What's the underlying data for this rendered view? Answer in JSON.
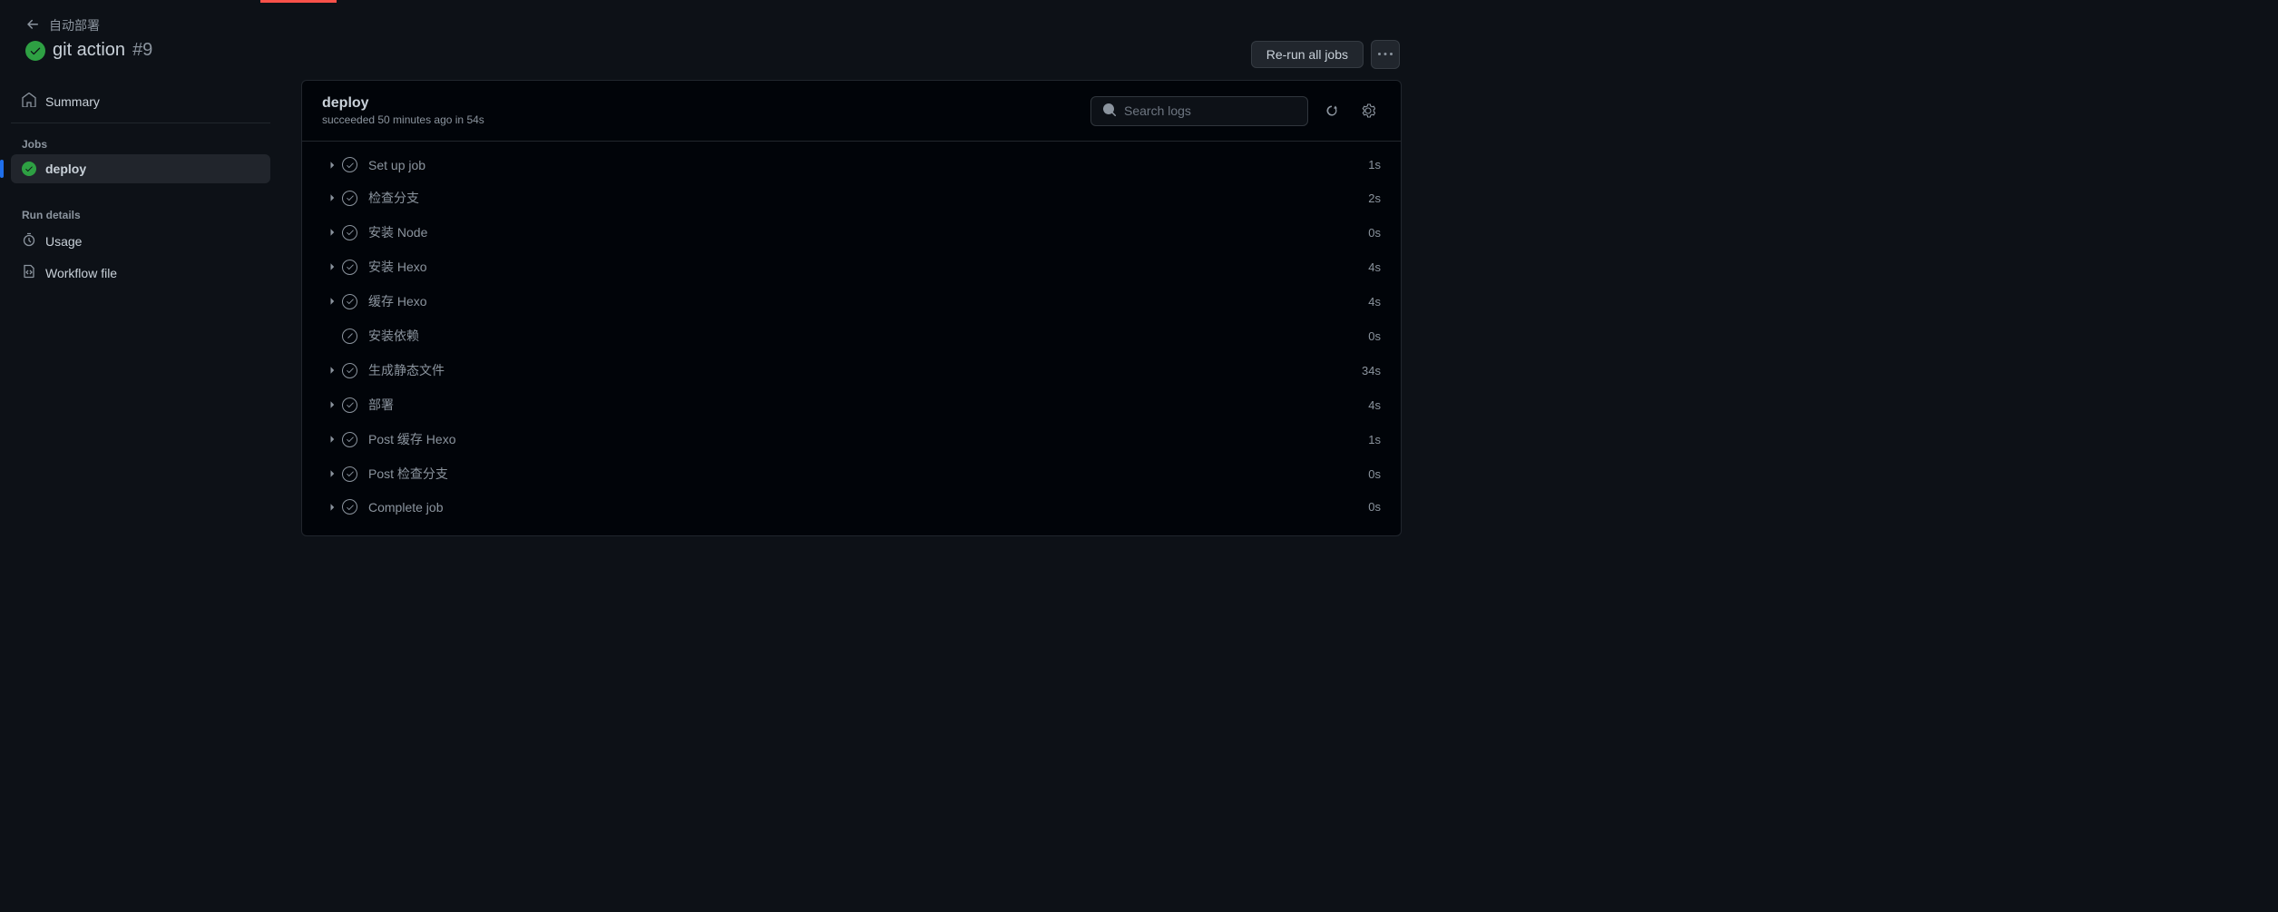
{
  "breadcrumb": {
    "label": "自动部署"
  },
  "workflow": {
    "title": "git action",
    "number": "#9"
  },
  "header_actions": {
    "rerun_label": "Re-run all jobs"
  },
  "sidebar": {
    "summary": "Summary",
    "jobs_heading": "Jobs",
    "run_details_heading": "Run details",
    "usage": "Usage",
    "workflow_file": "Workflow file",
    "jobs": [
      {
        "name": "deploy",
        "status": "success",
        "active": true
      }
    ]
  },
  "panel": {
    "job_name": "deploy",
    "subtext": "succeeded 50 minutes ago in 54s",
    "search_placeholder": "Search logs",
    "steps": [
      {
        "name": "Set up job",
        "duration": "1s",
        "status": "success",
        "expandable": true
      },
      {
        "name": "检查分支",
        "duration": "2s",
        "status": "success",
        "expandable": true
      },
      {
        "name": "安装 Node",
        "duration": "0s",
        "status": "success",
        "expandable": true
      },
      {
        "name": "安装 Hexo",
        "duration": "4s",
        "status": "success",
        "expandable": true
      },
      {
        "name": "缓存 Hexo",
        "duration": "4s",
        "status": "success",
        "expandable": true
      },
      {
        "name": "安装依赖",
        "duration": "0s",
        "status": "skipped",
        "expandable": false
      },
      {
        "name": "生成静态文件",
        "duration": "34s",
        "status": "success",
        "expandable": true
      },
      {
        "name": "部署",
        "duration": "4s",
        "status": "success",
        "expandable": true
      },
      {
        "name": "Post 缓存 Hexo",
        "duration": "1s",
        "status": "success",
        "expandable": true
      },
      {
        "name": "Post 检查分支",
        "duration": "0s",
        "status": "success",
        "expandable": true
      },
      {
        "name": "Complete job",
        "duration": "0s",
        "status": "success",
        "expandable": true
      }
    ]
  }
}
